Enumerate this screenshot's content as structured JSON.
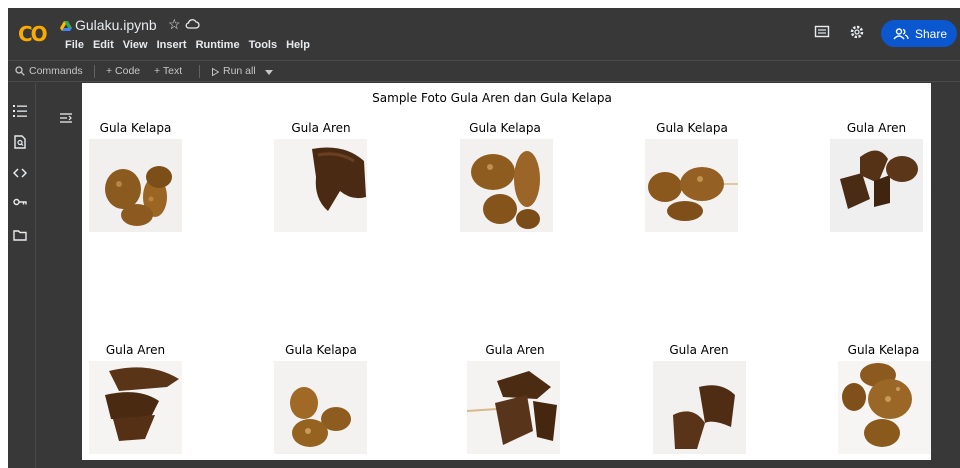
{
  "header": {
    "logo": "CO",
    "filename": "Gulaku.ipynb",
    "star": "☆",
    "menu": [
      "File",
      "Edit",
      "View",
      "Insert",
      "Runtime",
      "Tools",
      "Help"
    ],
    "share_label": "Share",
    "accent_color": "#0b57d0",
    "logo_color": "#f9ab00"
  },
  "toolbar": {
    "commands_label": "Commands",
    "add_code_label": "+ Code",
    "add_text_label": "+ Text",
    "run_all_label": "Run all"
  },
  "sidebar": {
    "icons": [
      "table-of-contents-icon",
      "find-replace-icon",
      "code-snippets-icon",
      "secrets-key-icon",
      "files-folder-icon"
    ]
  },
  "output": {
    "figure_title": "Sample Foto Gula Aren dan Gula Kelapa",
    "images": [
      {
        "label": "Gula Kelapa"
      },
      {
        "label": "Gula Aren"
      },
      {
        "label": "Gula Kelapa"
      },
      {
        "label": "Gula Kelapa"
      },
      {
        "label": "Gula Aren"
      },
      {
        "label": "Gula Aren"
      },
      {
        "label": "Gula Kelapa"
      },
      {
        "label": "Gula Aren"
      },
      {
        "label": "Gula Aren"
      },
      {
        "label": "Gula Kelapa"
      }
    ]
  }
}
